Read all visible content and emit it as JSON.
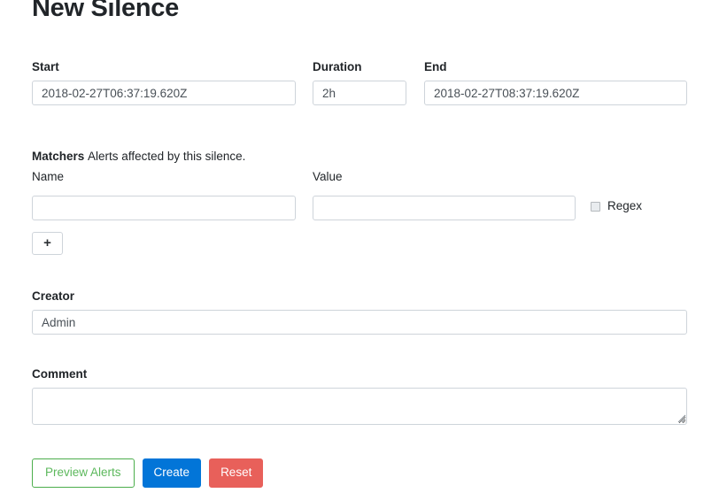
{
  "page": {
    "title": "New Silence"
  },
  "schedule": {
    "start": {
      "label": "Start",
      "value": "2018-02-27T06:37:19.620Z",
      "placeholder": ""
    },
    "duration": {
      "label": "Duration",
      "value": "2h",
      "placeholder": ""
    },
    "end": {
      "label": "End",
      "value": "2018-02-27T08:37:19.620Z",
      "placeholder": ""
    }
  },
  "matchers": {
    "heading": "Matchers",
    "description": "Alerts affected by this silence.",
    "name": {
      "label": "Name",
      "value": "",
      "placeholder": ""
    },
    "value": {
      "label": "Value",
      "value": "",
      "placeholder": ""
    },
    "regex": {
      "label": "Regex",
      "checked": false
    },
    "add_button_label": "+"
  },
  "creator": {
    "label": "Creator",
    "value": "Admin",
    "placeholder": ""
  },
  "comment": {
    "label": "Comment",
    "value": "",
    "placeholder": ""
  },
  "actions": {
    "preview_label": "Preview Alerts",
    "create_label": "Create",
    "reset_label": "Reset"
  },
  "colors": {
    "primary": "#0275d8",
    "danger": "#e8605a",
    "success": "#5cb85c",
    "border": "#ced4da",
    "text": "#212529"
  },
  "icons": {
    "plus": "plus-icon",
    "resize_grip": "resize-grip-icon",
    "checkbox": "checkbox-icon"
  }
}
